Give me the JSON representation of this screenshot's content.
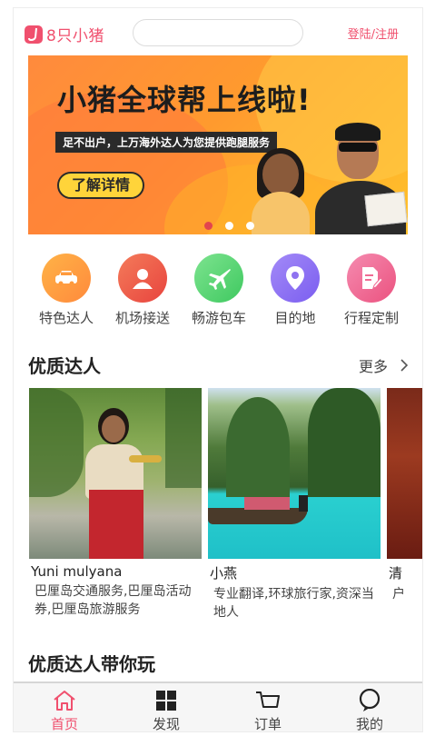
{
  "header": {
    "logo_text": "8只小猪",
    "search_placeholder": "",
    "login_label": "登陆/注册"
  },
  "banner": {
    "title": "小猪全球帮上线啦!",
    "subtitle": "足不出户，上万海外达人为您提供跑腿服务",
    "button_label": "了解详情",
    "dots": 3,
    "active_dot": 0
  },
  "categories": [
    {
      "label": "特色达人",
      "icon": "car-icon",
      "color": "#ff9a3c"
    },
    {
      "label": "机场接送",
      "icon": "user-icon",
      "color": "#ef5a4a"
    },
    {
      "label": "畅游包车",
      "icon": "airplane-icon",
      "color": "#5cd67a"
    },
    {
      "label": "目的地",
      "icon": "location-pin-icon",
      "color": "#8f73f0"
    },
    {
      "label": "行程定制",
      "icon": "document-edit-icon",
      "color": "#f06b94"
    }
  ],
  "featured": {
    "title": "优质达人",
    "more_label": "更多",
    "cards": [
      {
        "name": "Yuni mulyana",
        "desc": "巴厘岛交通服务,巴厘岛活动券,巴厘岛旅游服务"
      },
      {
        "name": "小燕",
        "desc": "专业翻译,环球旅行家,资深当地人"
      },
      {
        "name": "清",
        "desc": "户"
      }
    ]
  },
  "section2": {
    "title": "优质达人带你玩"
  },
  "tabbar": {
    "items": [
      {
        "label": "首页",
        "icon": "home-icon",
        "active": true
      },
      {
        "label": "发现",
        "icon": "grid-icon",
        "active": false
      },
      {
        "label": "订单",
        "icon": "cart-icon",
        "active": false
      },
      {
        "label": "我的",
        "icon": "profile-icon",
        "active": false
      }
    ]
  },
  "colors": {
    "accent": "#f0506e",
    "dot_active": "#e2454f"
  }
}
